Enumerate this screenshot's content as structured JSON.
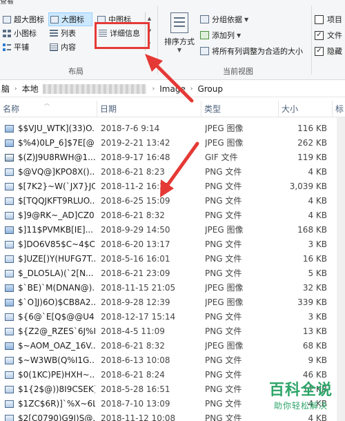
{
  "ribbon": {
    "tab_stub": "查看",
    "layout": {
      "items": [
        {
          "label": "超大图标",
          "icon": "extra-large-icons-icon"
        },
        {
          "label": "大图标",
          "icon": "large-icons-icon"
        },
        {
          "label": "中图标",
          "icon": "medium-icons-icon"
        },
        {
          "label": "小图标",
          "icon": "small-icons-icon"
        },
        {
          "label": "列表",
          "icon": "list-icon"
        },
        {
          "label": "详细信息",
          "icon": "details-icon"
        },
        {
          "label": "平铺",
          "icon": "tiles-icon"
        },
        {
          "label": "内容",
          "icon": "content-icon"
        }
      ],
      "selected": "大图标",
      "group_label": "布局"
    },
    "current_view": {
      "sort_label": "排序方式",
      "group_by_label": "分组依据",
      "add_column_label": "添加列",
      "fit_columns_label": "将所有列调整为合适的大小",
      "group_label": "当前视图"
    },
    "show_hide": {
      "items": [
        {
          "label": "项目",
          "checked": false
        },
        {
          "label": "文件",
          "checked": true
        },
        {
          "label": "隐藏",
          "checked": true
        }
      ]
    },
    "highlight_color": "#e53935"
  },
  "address": {
    "crumbs": [
      "脑",
      "本地",
      "Image",
      "Group"
    ]
  },
  "columns": {
    "name": "名称",
    "date": "日期",
    "type": "类型",
    "size": "大小",
    "tags": "标"
  },
  "files": [
    {
      "name": "$$VJU_WTK](33)O...",
      "date": "2018-7-6 9:14",
      "type": "JPEG 图像",
      "size": "116 KB",
      "kind": "jpeg"
    },
    {
      "name": "$%4)0LP_6]$7E[@...",
      "date": "2019-2-21 13:42",
      "type": "JPEG 图像",
      "size": "262 KB",
      "kind": "jpeg"
    },
    {
      "name": "$(Z)J9U8RWH@1...",
      "date": "2018-9-17 16:48",
      "type": "GIF 文件",
      "size": "119 KB",
      "kind": "gif"
    },
    {
      "name": "$@VQ@]KPO8X()...",
      "date": "2018-6-21 8:23",
      "type": "PNG 文件",
      "size": "4 KB",
      "kind": "png"
    },
    {
      "name": "$[7K2}~W(`JX7}JO...",
      "date": "2018-11-2 16:25",
      "type": "PNG 文件",
      "size": "3,039 KB",
      "kind": "png"
    },
    {
      "name": "$[TQQJKFT9RLUO...",
      "date": "2018-6-25 15:09",
      "type": "PNG 文件",
      "size": "4 KB",
      "kind": "png"
    },
    {
      "name": "$]9@RK~_AD]CZ0...",
      "date": "2018-6-21 8:32",
      "type": "PNG 文件",
      "size": "4 KB",
      "kind": "png"
    },
    {
      "name": "$]11$PVMKB[IE]...",
      "date": "2018-9-29 14:50",
      "type": "JPEG 图像",
      "size": "168 KB",
      "kind": "jpeg"
    },
    {
      "name": "$]DO6V85$C~4$C...",
      "date": "2018-6-20 13:17",
      "type": "PNG 文件",
      "size": "3 KB",
      "kind": "png"
    },
    {
      "name": "$]UZE[)Y(HUFG7T...",
      "date": "2018-5-16 16:01",
      "type": "PNG 文件",
      "size": "16 KB",
      "kind": "png"
    },
    {
      "name": "$_DLO5LA)(`2[N...",
      "date": "2018-6-21 23:09",
      "type": "PNG 文件",
      "size": "5 KB",
      "kind": "png"
    },
    {
      "name": "$`BE)`M(DNAN@)...",
      "date": "2018-11-15 21:05",
      "type": "JPEG 图像",
      "size": "32 KB",
      "kind": "jpeg"
    },
    {
      "name": "$`O]J)6O)$CB8A2...",
      "date": "2018-9-28 12:39",
      "type": "JPEG 图像",
      "size": "339 KB",
      "kind": "jpeg"
    },
    {
      "name": "${6@`E[Q$@@U4...",
      "date": "2018-12-17 15:14",
      "type": "PNG 文件",
      "size": "3 KB",
      "kind": "png"
    },
    {
      "name": "${Z2@_RZES`6J%I...",
      "date": "2018-4-5 11:09",
      "type": "PNG 文件",
      "size": "13 KB",
      "kind": "png"
    },
    {
      "name": "$~AOM_OAZ_16V...",
      "date": "2018-6-21 8:32",
      "type": "JPEG 图像",
      "size": "68 KB",
      "kind": "jpeg"
    },
    {
      "name": "$~W3WB(Q%I1G...",
      "date": "2018-6-13 10:08",
      "type": "PNG 文件",
      "size": "9 KB",
      "kind": "png"
    },
    {
      "name": "$0(1KC)PE)HXH~...",
      "date": "2018-6-21 8:24",
      "type": "PNG 文件",
      "size": "46 KB",
      "kind": "png"
    },
    {
      "name": "$1{2$@))8I9CSEK]...",
      "date": "2018-5-28 16:51",
      "type": "PNG 文件",
      "size": "11 KB",
      "kind": "png"
    },
    {
      "name": "$1ZC$6R)]`%X~6L...",
      "date": "2018-7-10 13:09",
      "type": "PNG 文件",
      "size": "4 KB",
      "kind": "png"
    },
    {
      "name": "$2[C0790)G9I)S@...",
      "date": "2018-11-12 10:08",
      "type": "PNG 文件",
      "size": "4 KB",
      "kind": "png"
    },
    {
      "name": "$4QBWQN}RWM...",
      "date": "2018-12-17 11:07",
      "type": "JPEG 图像",
      "size": "13 KB",
      "kind": "jpeg"
    }
  ],
  "watermark": {
    "title": "百科全说",
    "subtitle": "助你轻松解决"
  },
  "colors": {
    "accent_selected": "#cce8ff",
    "header_text": "#4c607a",
    "annotation": "#e53935",
    "watermark": "#2ea66a"
  }
}
